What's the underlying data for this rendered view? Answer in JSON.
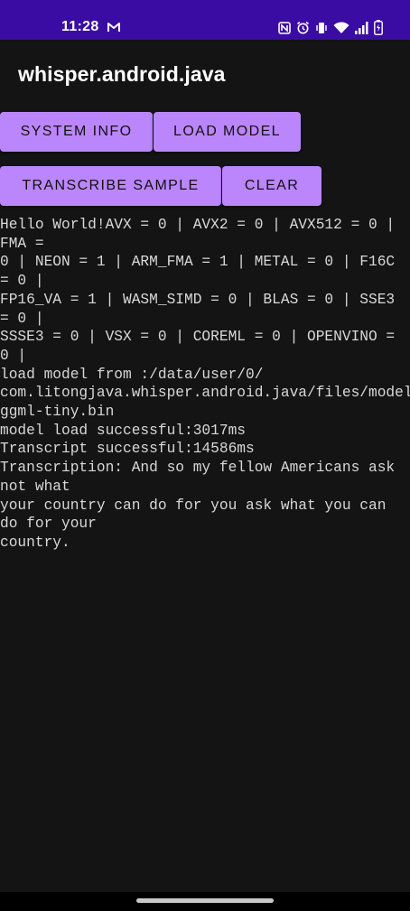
{
  "status_bar": {
    "time": "11:28",
    "icons": [
      "gmail-m-icon",
      "nfc-icon",
      "alarm-icon",
      "vibrate-icon",
      "wifi-icon",
      "signal-icon",
      "battery-icon"
    ],
    "background": "#3a0ca3"
  },
  "app_bar": {
    "title": "whisper.android.java"
  },
  "buttons": {
    "system_info": "System Info",
    "load_model": "Load Model",
    "transcribe_sample": "Transcribe Sample",
    "clear": "Clear",
    "color": "#bb86fc"
  },
  "log": {
    "text": "Hello World!AVX = 0 | AVX2 = 0 | AVX512 = 0 | FMA =\n0 | NEON = 1 | ARM_FMA = 1 | METAL = 0 | F16C = 0 |\nFP16_VA = 1 | WASM_SIMD = 0 | BLAS = 0 | SSE3 = 0 |\nSSSE3 = 0 | VSX = 0 | COREML = 0 | OPENVINO = 0 |\nload model from :/data/user/0/\ncom.litongjava.whisper.android.java/files/models/\nggml-tiny.bin\nmodel load successful:3017ms\nTranscript successful:14586ms\nTranscription: And so my fellow Americans ask not what\nyour country can do for you ask what you can do for your\ncountry."
  }
}
